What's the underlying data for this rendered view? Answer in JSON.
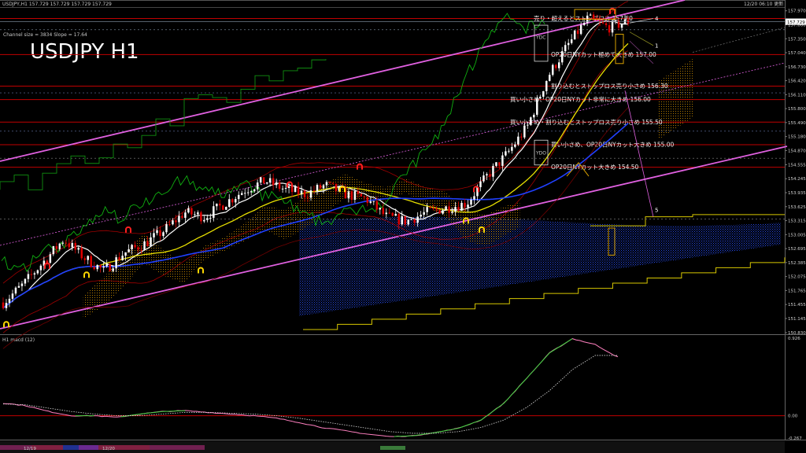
{
  "window": {
    "title": "USDJPY,H1  157.729 157.729 157.729 157.729",
    "datetime": "12/20 06:10 更新",
    "subtitle": "Channel size = 3834 Slope = 17.64",
    "symbol_label": "USDJPY H1"
  },
  "colors": {
    "background": "#000000",
    "bull": "#ffffff",
    "bear": "#e00000",
    "resistance_line": "#c00000",
    "channel": "#e060e0",
    "ma_white": "#ffffff",
    "ma_yellow": "#e8e000",
    "ma_blue": "#2040ff",
    "chikou": "#10b010",
    "cloud_blue": "#2850ff",
    "cloud_orange": "#ffb000",
    "macd": "#3cd23c",
    "macd_signal": "#ff80c0"
  },
  "chart_data": [
    {
      "type": "candlestick",
      "title": "USDJPY H1",
      "ylim": [
        150.83,
        158.0
      ],
      "y_ticks": [
        "157.970",
        "157.660",
        "157.350",
        "157.040",
        "156.730",
        "156.420",
        "156.110",
        "155.800",
        "155.490",
        "155.180",
        "154.870",
        "154.555",
        "154.245",
        "153.935",
        "153.625",
        "153.315",
        "153.005",
        "152.695",
        "152.385",
        "152.075",
        "151.765",
        "151.455",
        "151.145",
        "150.830"
      ],
      "current_price_label": "157.729",
      "price_levels": [
        {
          "price": 157.8,
          "label": "売り・超えるとストップロス 157.80"
        },
        {
          "price": 157.0,
          "label": "OP20日NYカット極めて大きめ 157.00"
        },
        {
          "price": 156.3,
          "label": "割り込むとストップロス売り小さめ 156.30"
        },
        {
          "price": 156.0,
          "label": "買い小さめ、OP20日NYカット非常に大きめ 156.00"
        },
        {
          "price": 155.5,
          "label": "買い小さめ・割り込むとストップロス売り小さめ 155.50"
        },
        {
          "price": 155.0,
          "label": "買い小さめ、OP20日NYカット大きめ 155.00"
        },
        {
          "price": 154.5,
          "label": "OP20日NYカット大きめ 154.50"
        }
      ],
      "box_labels": [
        "YDC",
        "YDO"
      ],
      "wave_labels": [
        "4",
        "1",
        "5"
      ],
      "x_labels": [
        "12/19",
        "12/20"
      ],
      "series": [
        {
          "type": "candles",
          "approx_path": [
            151.5,
            151.9,
            152.4,
            152.9,
            152.5,
            152.2,
            152.6,
            152.8,
            153.1,
            153.5,
            153.4,
            153.7,
            154.0,
            154.2,
            154.0,
            153.9,
            154.1,
            153.9,
            153.8,
            153.4,
            153.3,
            153.5,
            153.6,
            153.7,
            154.3,
            154.8,
            155.4,
            156.5,
            157.2,
            157.8,
            157.6,
            157.73
          ]
        }
      ]
    },
    {
      "type": "line",
      "title": "H1 macd (12)",
      "y_ticks": [
        "0.926",
        "0.00",
        "-0.267"
      ],
      "series": [
        {
          "type": "macd",
          "values": [
            0.15,
            0.12,
            0.05,
            0.0,
            0.0,
            -0.02,
            0.02,
            0.05,
            0.06,
            0.04,
            0.02,
            0.0,
            -0.03,
            -0.08,
            -0.14,
            -0.18,
            -0.22,
            -0.25,
            -0.24,
            -0.2,
            -0.15,
            -0.05,
            0.15,
            0.45,
            0.75,
            0.92,
            0.85,
            0.7
          ]
        },
        {
          "type": "signal",
          "values": [
            0.14,
            0.13,
            0.09,
            0.05,
            0.02,
            0.0,
            0.0,
            0.02,
            0.04,
            0.04,
            0.03,
            0.02,
            0.0,
            -0.03,
            -0.07,
            -0.11,
            -0.15,
            -0.19,
            -0.21,
            -0.21,
            -0.19,
            -0.14,
            -0.05,
            0.1,
            0.3,
            0.55,
            0.72,
            0.72
          ]
        }
      ]
    }
  ]
}
